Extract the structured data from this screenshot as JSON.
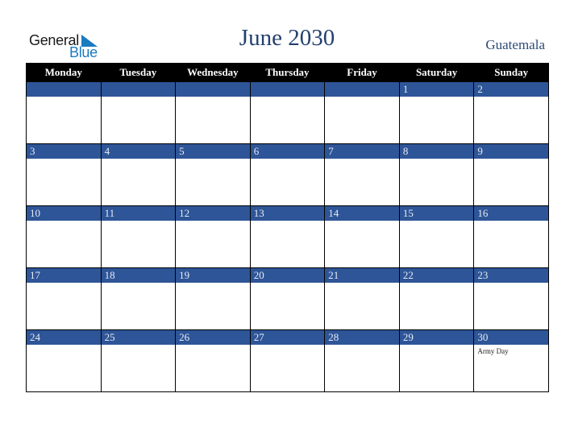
{
  "brand": {
    "general": "General",
    "blue": "Blue",
    "accent": "#1a7bc1"
  },
  "title": "June 2030",
  "country": "Guatemala",
  "colors": {
    "header_bg": "#000000",
    "day_bar": "#2e5597",
    "title": "#23406e"
  },
  "weekdays": [
    "Monday",
    "Tuesday",
    "Wednesday",
    "Thursday",
    "Friday",
    "Saturday",
    "Sunday"
  ],
  "weeks": [
    [
      {
        "day": ""
      },
      {
        "day": ""
      },
      {
        "day": ""
      },
      {
        "day": ""
      },
      {
        "day": ""
      },
      {
        "day": "1"
      },
      {
        "day": "2"
      }
    ],
    [
      {
        "day": "3"
      },
      {
        "day": "4"
      },
      {
        "day": "5"
      },
      {
        "day": "6"
      },
      {
        "day": "7"
      },
      {
        "day": "8"
      },
      {
        "day": "9"
      }
    ],
    [
      {
        "day": "10"
      },
      {
        "day": "11"
      },
      {
        "day": "12"
      },
      {
        "day": "13"
      },
      {
        "day": "14"
      },
      {
        "day": "15"
      },
      {
        "day": "16"
      }
    ],
    [
      {
        "day": "17"
      },
      {
        "day": "18"
      },
      {
        "day": "19"
      },
      {
        "day": "20"
      },
      {
        "day": "21"
      },
      {
        "day": "22"
      },
      {
        "day": "23"
      }
    ],
    [
      {
        "day": "24"
      },
      {
        "day": "25"
      },
      {
        "day": "26"
      },
      {
        "day": "27"
      },
      {
        "day": "28"
      },
      {
        "day": "29"
      },
      {
        "day": "30",
        "holiday": "Army Day"
      }
    ]
  ]
}
